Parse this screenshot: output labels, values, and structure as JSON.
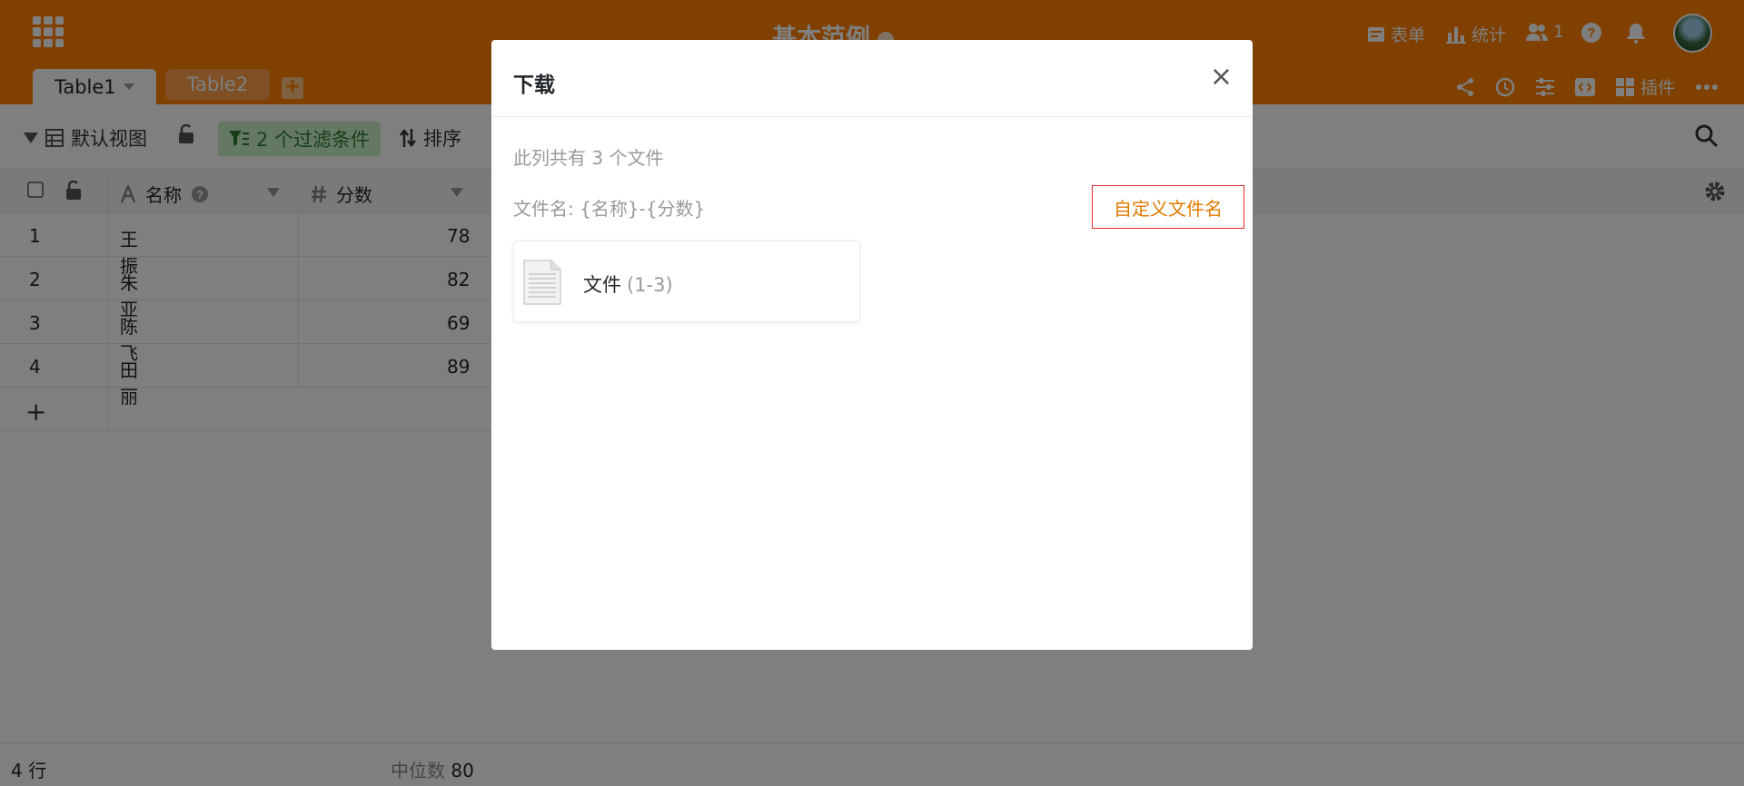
{
  "header": {
    "base_title": "基本范例",
    "form_label": "表单",
    "stats_label": "统计",
    "collaborators_count": "1",
    "plugins_label": "插件"
  },
  "tabs": [
    {
      "label": "Table1",
      "active": true
    },
    {
      "label": "Table2",
      "active": false
    }
  ],
  "toolbar": {
    "view_name": "默认视图",
    "filter_label": "2 个过滤条件",
    "sort_label": "排序"
  },
  "grid": {
    "columns": [
      {
        "name": "名称",
        "type_icon": "text-icon"
      },
      {
        "name": "分数",
        "type_icon": "number-icon"
      }
    ],
    "rows": [
      {
        "index": "1",
        "name": "王振",
        "score": "78"
      },
      {
        "index": "2",
        "name": "朱亚",
        "score": "82"
      },
      {
        "index": "3",
        "name": "陈飞",
        "score": "69"
      },
      {
        "index": "4",
        "name": "田丽",
        "score": "89"
      }
    ],
    "add_row": "+"
  },
  "footer": {
    "row_count": "4 行",
    "median_label": "中位数",
    "median_value": "80"
  },
  "modal": {
    "title": "下载",
    "close": "×",
    "file_count_text": "此列共有 3 个文件",
    "filename_pattern": "文件名: {名称}-{分数}",
    "custom_filename_button": "自定义文件名",
    "file_label": "文件",
    "file_range": "(1-3)"
  },
  "colors": {
    "brand": "#FF8000",
    "overlay": "rgba(0,0,0,0.5)",
    "filter_bg": "#c8f0c8",
    "button_border": "#e02b2b"
  }
}
